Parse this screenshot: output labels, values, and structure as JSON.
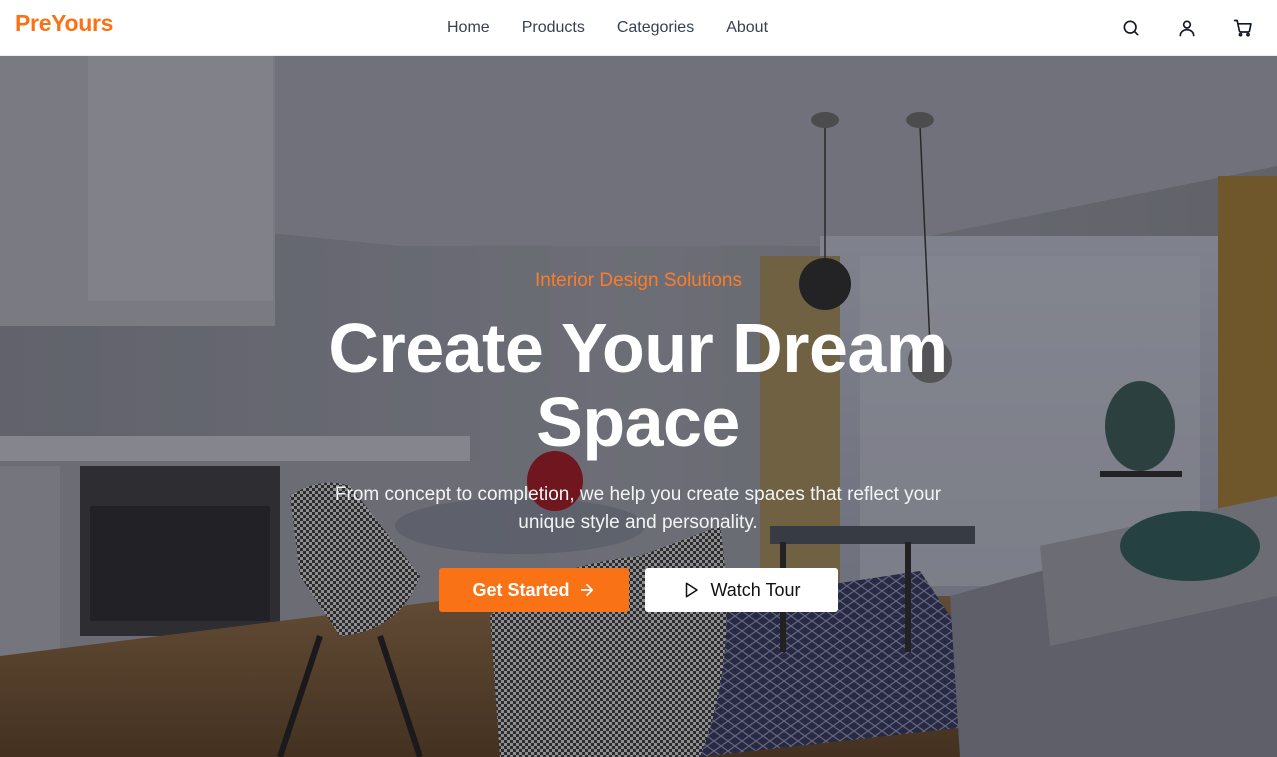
{
  "brand": {
    "name": "PreYours",
    "color": "#f97316"
  },
  "nav": {
    "links": [
      {
        "label": "Home"
      },
      {
        "label": "Products"
      },
      {
        "label": "Categories"
      },
      {
        "label": "About"
      }
    ],
    "actions": [
      {
        "icon": "search-icon"
      },
      {
        "icon": "user-icon"
      },
      {
        "icon": "cart-icon"
      }
    ]
  },
  "hero": {
    "eyebrow": "Interior Design Solutions",
    "title": "Create Your Dream Space",
    "subtitle": "From concept to completion, we help you create spaces that reflect your unique style and personality.",
    "primary_cta": {
      "label": "Get Started",
      "icon": "arrow-right-icon"
    },
    "secondary_cta": {
      "label": "Watch Tour",
      "icon": "play-icon"
    },
    "background": "interior-living-room-photo"
  }
}
